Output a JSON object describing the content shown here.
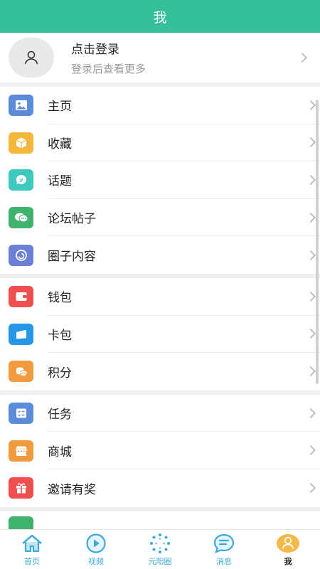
{
  "header": {
    "title": "我"
  },
  "profile": {
    "title": "点击登录",
    "subtitle": "登录后查看更多"
  },
  "sections": [
    {
      "items": [
        {
          "label": "主页",
          "icon": "image-icon",
          "color": "#5b8bd9"
        },
        {
          "label": "收藏",
          "icon": "box-icon",
          "color": "#f3b73a"
        },
        {
          "label": "话题",
          "icon": "chat-hash-icon",
          "color": "#3dc9c0"
        },
        {
          "label": "论坛帖子",
          "icon": "forum-icon",
          "color": "#3fb36d"
        },
        {
          "label": "圈子内容",
          "icon": "circle-icon",
          "color": "#6b7fd6"
        }
      ]
    },
    {
      "items": [
        {
          "label": "钱包",
          "icon": "wallet-icon",
          "color": "#ef4f4f"
        },
        {
          "label": "卡包",
          "icon": "card-icon",
          "color": "#2597e6"
        },
        {
          "label": "积分",
          "icon": "coins-icon",
          "color": "#f19a3e"
        }
      ]
    },
    {
      "items": [
        {
          "label": "任务",
          "icon": "task-icon",
          "color": "#5b8bd9"
        },
        {
          "label": "商城",
          "icon": "shop-icon",
          "color": "#f19a3e"
        },
        {
          "label": "邀请有奖",
          "icon": "gift-icon",
          "color": "#ef4f4f"
        }
      ]
    }
  ],
  "tabbar": [
    {
      "label": "首页",
      "icon": "home-icon"
    },
    {
      "label": "视频",
      "icon": "video-icon"
    },
    {
      "label": "元阳圈",
      "icon": "dots-circle-icon"
    },
    {
      "label": "消息",
      "icon": "message-icon"
    },
    {
      "label": "我",
      "icon": "user-icon",
      "active": true
    }
  ]
}
